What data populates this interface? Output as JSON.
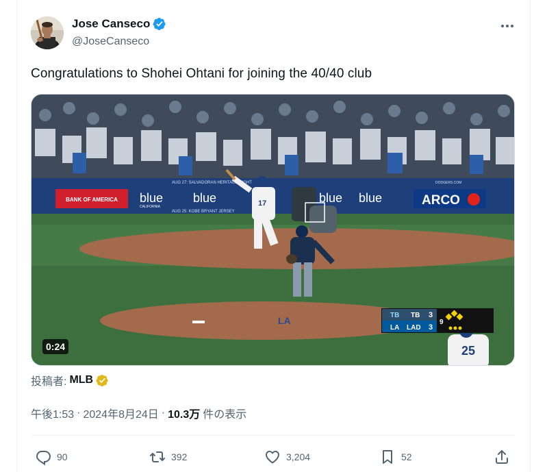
{
  "author": {
    "name": "Jose Canseco",
    "handle": "@JoseCanseco",
    "verified_icon": "verified-badge-icon",
    "avatar": "avatar"
  },
  "more_icon": "more-dots-icon",
  "tweet": {
    "text": "Congratulations to Shohei Ohtani for joining the 40/40 club"
  },
  "media": {
    "duration": "0:24",
    "banners": {
      "date_top": "AUG 27: SALVADORAN HERITAGE NIGHT",
      "date_bottom": "AUG 25: KOBE BRYANT JERSEY",
      "bank": "BANK OF AMERICA",
      "blue1": "blue",
      "blue2": "blue",
      "blue3": "blue",
      "blue4": "blue",
      "california": "CALIFORNIA",
      "arco": "ARCO",
      "dodgers_url": "DODGERS.COM"
    },
    "player_numbers": {
      "batter": "17",
      "runner": "25"
    },
    "scoreboard": {
      "away_logo": "TB",
      "away_team": "TB",
      "away_score": "3",
      "home_logo": "LA",
      "home_team": "LAD",
      "home_score": "3",
      "inning": "9"
    },
    "mound_text": "LA"
  },
  "attribution": {
    "label": "投稿者:",
    "source": "MLB",
    "badge_color": "#e2b719"
  },
  "meta": {
    "time": "午後1:53",
    "sep1": "·",
    "date": "2024年8月24日",
    "sep2": "·",
    "views_count": "10.3万",
    "views_label": "件の表示"
  },
  "actions": {
    "reply": {
      "icon": "reply-icon",
      "count": "90"
    },
    "retweet": {
      "icon": "retweet-icon",
      "count": "392"
    },
    "like": {
      "icon": "heart-icon",
      "count": "3,204"
    },
    "bookmark": {
      "icon": "bookmark-icon",
      "count": "52"
    },
    "share": {
      "icon": "share-icon"
    }
  },
  "colors": {
    "verified_blue": "#1d9bf0",
    "text_primary": "#0f1419",
    "text_secondary": "#536471"
  }
}
